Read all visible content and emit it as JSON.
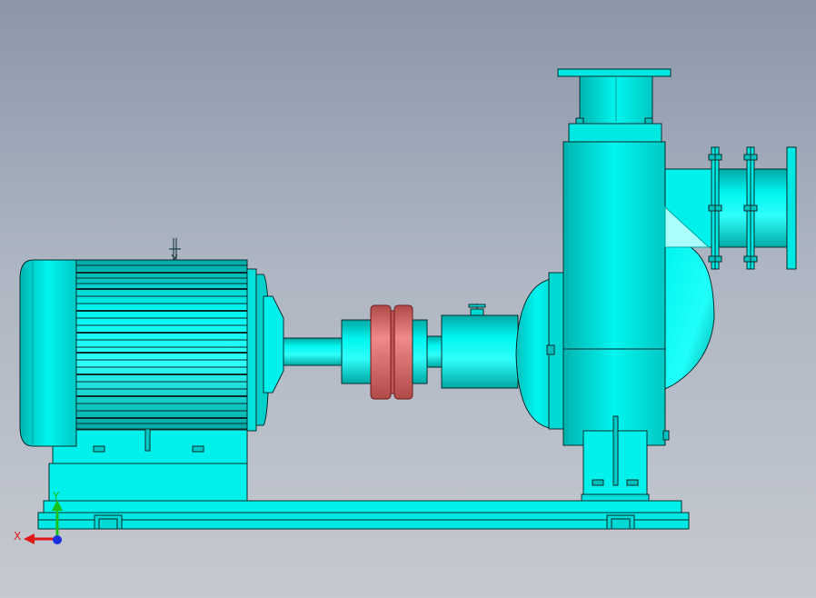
{
  "viewport": {
    "background_top": "#8b96a9",
    "background_bottom": "#c5c9d0"
  },
  "colors": {
    "body": "#00f5f0",
    "body_shade": "#00c8c4",
    "body_dark": "#009e9a",
    "edge": "#0b2e2e",
    "coupling": "#e87a78",
    "coupling_shade": "#c05553"
  },
  "triad": {
    "x_label": "X",
    "y_label": "Y",
    "x_color": "#e01818",
    "y_color": "#18c018",
    "z_color": "#1830e0"
  },
  "parts": [
    "motor",
    "motor-cooling-fins",
    "motor-base",
    "motor-shaft",
    "coupling",
    "bearing-housing",
    "pump-volute",
    "discharge-flange",
    "suction-pipe",
    "suction-flanges",
    "pump-support",
    "base-frame"
  ]
}
